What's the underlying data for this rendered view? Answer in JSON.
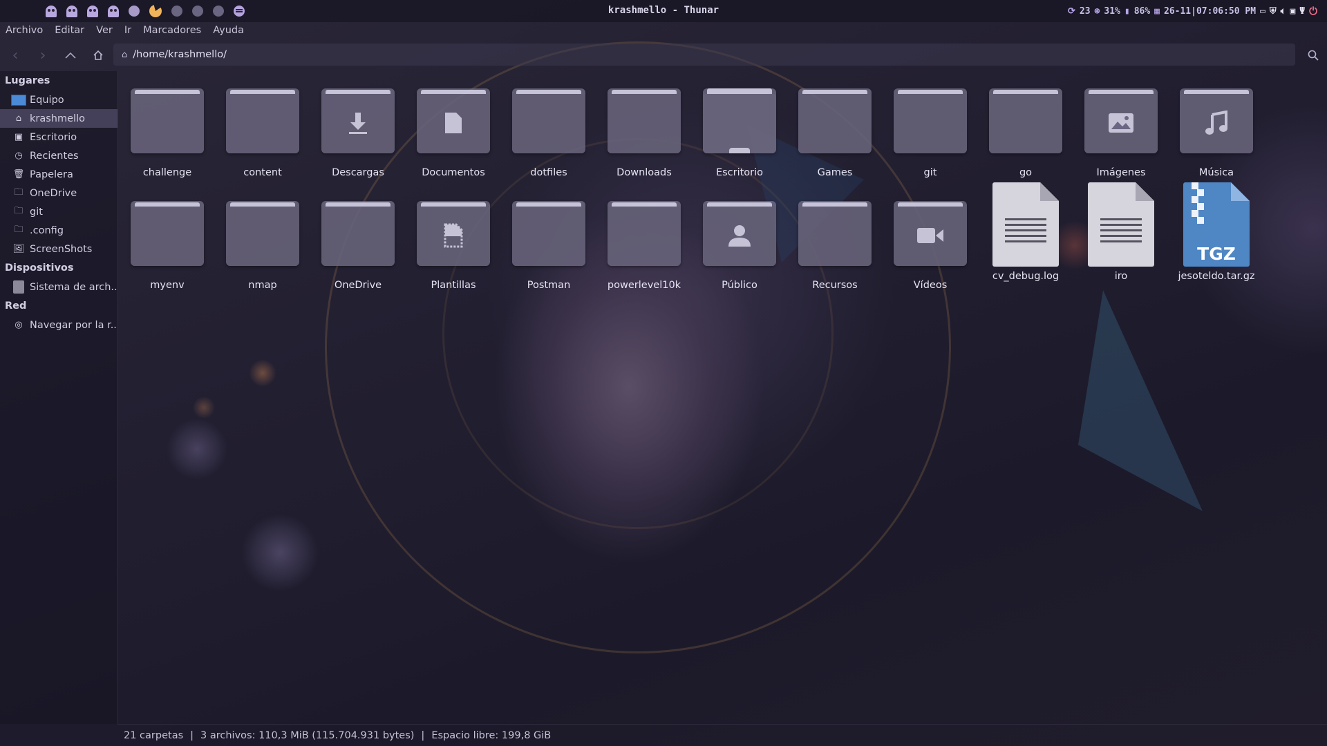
{
  "window_title": "krashmello - Thunar",
  "system_tray": {
    "updates_count": "23",
    "cpu": "31%",
    "battery": "86%",
    "datetime": "26-11|07:06:50 PM",
    "icons": [
      "updates-icon",
      "cpu-icon",
      "battery-icon",
      "calendar-icon",
      "screen-icon",
      "shield-icon",
      "volume-icon",
      "image-icon",
      "usb-icon",
      "power-icon"
    ]
  },
  "workspaces": [
    "ghost",
    "ghost",
    "ghost",
    "ghost",
    "dot",
    "pacman",
    "dot",
    "dot",
    "dot",
    "spotify"
  ],
  "menu": [
    "Archivo",
    "Editar",
    "Ver",
    "Ir",
    "Marcadores",
    "Ayuda"
  ],
  "location": "/home/krashmello/",
  "sidebar": {
    "sections": [
      {
        "title": "Lugares",
        "items": [
          {
            "label": "Equipo",
            "icon": "computer-icon"
          },
          {
            "label": "krashmello",
            "icon": "home-icon",
            "selected": true
          },
          {
            "label": "Escritorio",
            "icon": "desktop-icon"
          },
          {
            "label": "Recientes",
            "icon": "clock-icon"
          },
          {
            "label": "Papelera",
            "icon": "trash-icon"
          },
          {
            "label": "OneDrive",
            "icon": "folder-icon"
          },
          {
            "label": "git",
            "icon": "folder-icon"
          },
          {
            "label": ".config",
            "icon": "folder-icon"
          },
          {
            "label": "ScreenShots",
            "icon": "image-folder-icon"
          }
        ]
      },
      {
        "title": "Dispositivos",
        "items": [
          {
            "label": "Sistema de arch...",
            "icon": "disk-icon"
          }
        ]
      },
      {
        "title": "Red",
        "items": [
          {
            "label": "Navegar por la r...",
            "icon": "network-icon"
          }
        ]
      }
    ]
  },
  "files": [
    {
      "name": "challenge",
      "kind": "folder"
    },
    {
      "name": "content",
      "kind": "folder"
    },
    {
      "name": "Descargas",
      "kind": "folder",
      "emblem": "download"
    },
    {
      "name": "Documentos",
      "kind": "folder",
      "emblem": "document"
    },
    {
      "name": "dotfiles",
      "kind": "folder"
    },
    {
      "name": "Downloads",
      "kind": "folder"
    },
    {
      "name": "Escritorio",
      "kind": "folder",
      "emblem": "desktop"
    },
    {
      "name": "Games",
      "kind": "folder"
    },
    {
      "name": "git",
      "kind": "folder"
    },
    {
      "name": "go",
      "kind": "folder"
    },
    {
      "name": "Imágenes",
      "kind": "folder",
      "emblem": "image"
    },
    {
      "name": "Música",
      "kind": "folder",
      "emblem": "music"
    },
    {
      "name": "myenv",
      "kind": "folder"
    },
    {
      "name": "nmap",
      "kind": "folder"
    },
    {
      "name": "OneDrive",
      "kind": "folder"
    },
    {
      "name": "Plantillas",
      "kind": "folder",
      "emblem": "template"
    },
    {
      "name": "Postman",
      "kind": "folder"
    },
    {
      "name": "powerlevel10k",
      "kind": "folder"
    },
    {
      "name": "Público",
      "kind": "folder",
      "emblem": "user"
    },
    {
      "name": "Recursos",
      "kind": "folder"
    },
    {
      "name": "Vídeos",
      "kind": "folder",
      "emblem": "video"
    },
    {
      "name": "cv_debug.log",
      "kind": "text"
    },
    {
      "name": "iro",
      "kind": "text"
    },
    {
      "name": "jesoteldo.tar.gz",
      "kind": "archive",
      "badge": "TGZ"
    }
  ],
  "status": {
    "folders": "21 carpetas",
    "files": "3 archivos: 110,3 MiB (115.704.931 bytes)",
    "free": "Espacio libre: 199,8 GiB",
    "separator": "|"
  }
}
